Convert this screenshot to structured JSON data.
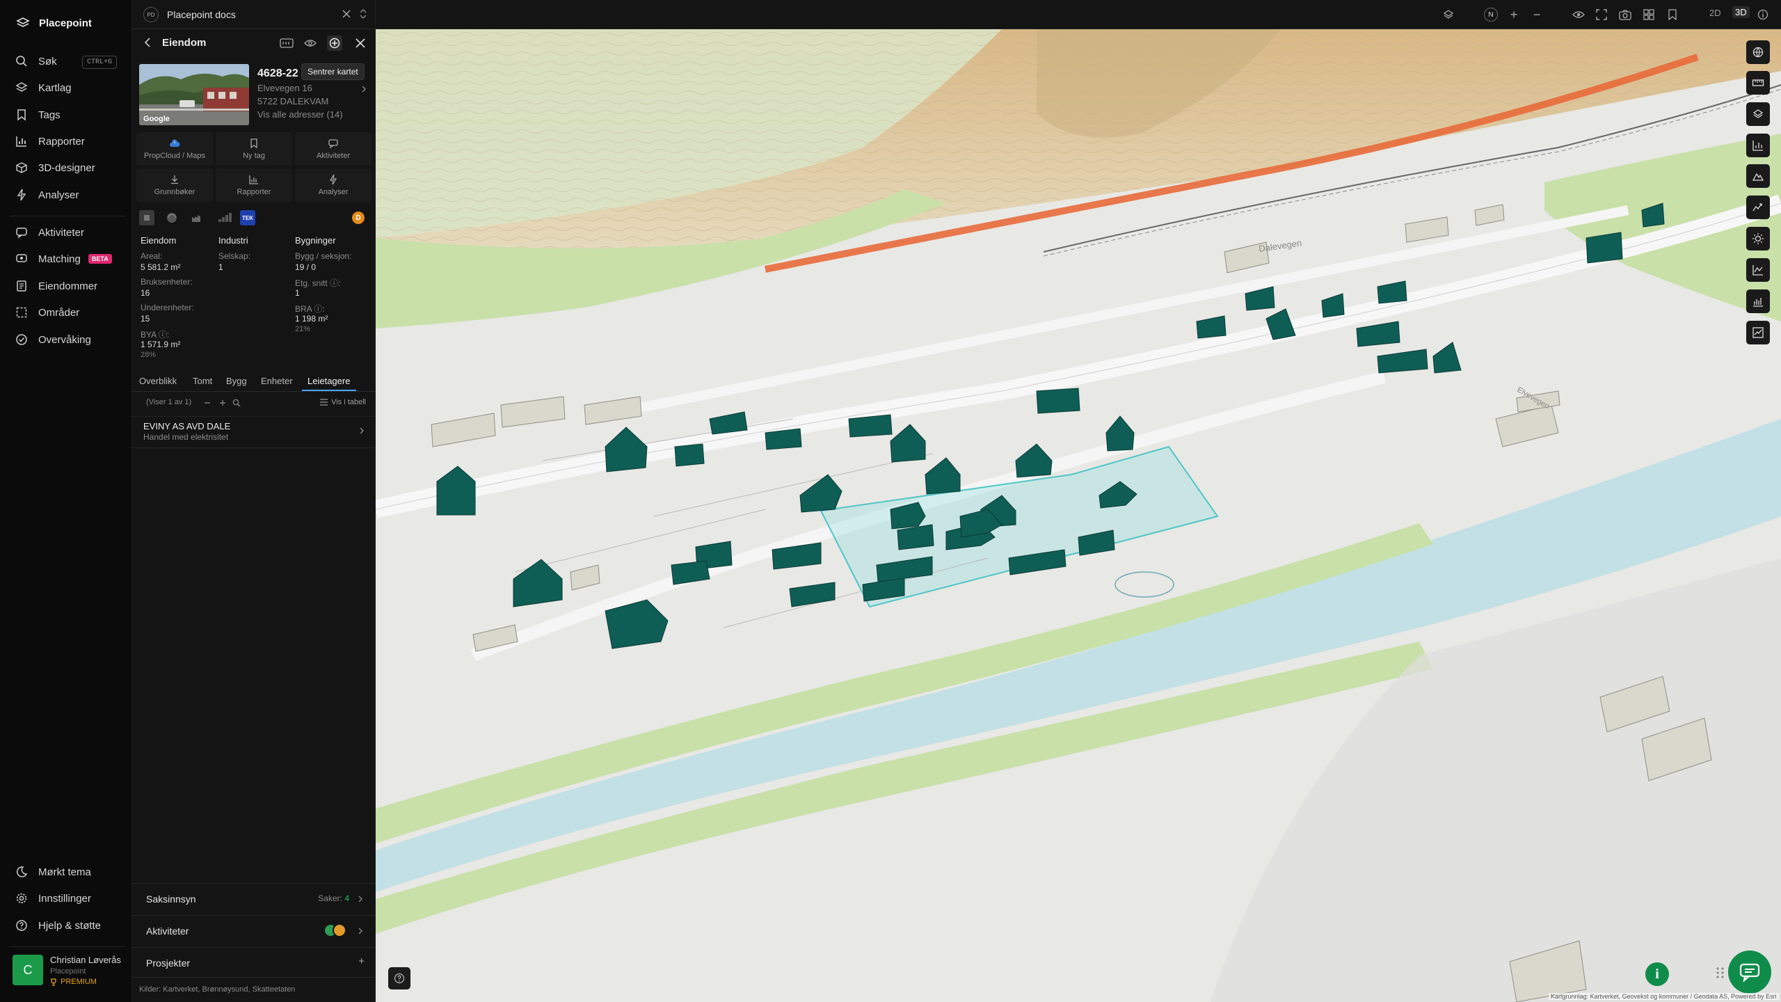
{
  "app": {
    "name": "Placepoint"
  },
  "nav": {
    "search": {
      "label": "Søk",
      "shortcut": "CTRL+G"
    },
    "items_top": [
      "Kartlag",
      "Tags",
      "Rapporter",
      "3D-designer",
      "Analyser"
    ],
    "aktiviteter": "Aktiviteter",
    "matching": {
      "label": "Matching",
      "badge": "BETA"
    },
    "eiendommer": "Eiendommer",
    "omrader": "Områder",
    "overvaking": "Overvåking",
    "bottom": [
      "Mørkt tema",
      "Innstillinger",
      "Hjelp & støtte"
    ],
    "user": {
      "initial": "C",
      "name": "Christian Løverås",
      "org": "Placepoint",
      "plan": "PREMIUM"
    }
  },
  "docs": {
    "badge": "PD",
    "title": "Placepoint docs"
  },
  "property": {
    "header": "Eiendom",
    "tooltip": "Sentrer kartet",
    "id": "4628-22",
    "address": "Elvevegen 16",
    "postal": "5722 DALEKVAM",
    "all_addresses": "Vis alle adresser (14)",
    "photo_credit": "Google"
  },
  "actions": [
    "PropCloud / Maps",
    "Ny tag",
    "Aktiviteter",
    "Grunnbøker",
    "Rapporter",
    "Analyser"
  ],
  "sources": {
    "tek": "TEK",
    "d": "D"
  },
  "stats": {
    "eiendom": {
      "heading": "Eiendom",
      "areal_label": "Areal:",
      "areal_value": "5 581.2 m²",
      "bruksenheter_label": "Bruksenheter:",
      "bruksenheter_value": "16",
      "underenheter_label": "Underenheter:",
      "underenheter_value": "15",
      "bya_label": "BYA ⓘ:",
      "bya_value": "1 571.9 m²",
      "bya_pct": "28%"
    },
    "industri": {
      "heading": "Industri",
      "selskap_label": "Selskap:",
      "selskap_value": "1"
    },
    "bygninger": {
      "heading": "Bygninger",
      "bygg_label": "Bygg / seksjon:",
      "bygg_value": "19 / 0",
      "etg_label": "Etg. snitt ⓘ:",
      "etg_value": "1",
      "bra_label": "BRA ⓘ:",
      "bra_value": "1 198 m²",
      "bra_pct": "21%"
    }
  },
  "tabs": [
    "Overblikk",
    "Tomt",
    "Bygg",
    "Enheter",
    "Leietagere"
  ],
  "active_tab": "Leietagere",
  "list": {
    "count": "(Viser 1 av 1)",
    "table_link": "Vis i tabell",
    "rows": [
      {
        "name": "EVINY AS AVD DALE",
        "desc": "Handel med elektrisitet"
      }
    ]
  },
  "sections": {
    "saksinnsyn": {
      "label": "Saksinnsyn",
      "meta_label": "Saker:",
      "meta_value": "4"
    },
    "aktiviteter": {
      "label": "Aktiviteter"
    },
    "prosjekter": {
      "label": "Prosjekter",
      "action": "+"
    }
  },
  "kilder": {
    "label": "Kilder:",
    "items": [
      "Kartverket,",
      "Brønnøysund,",
      "Skatteetaten"
    ]
  },
  "topbar": {
    "north": "N",
    "zoom_in": "+",
    "zoom_out": "−",
    "mode_2d": "2D",
    "mode_3d": "3D",
    "active_mode": "3D"
  },
  "map": {
    "street_labels": [
      "Dalevegen",
      "Elvevegen"
    ],
    "attribution": "Kartgrunnlag: Kartverket, Geovekst og kommuner / Geodata AS, Powered by Esri"
  },
  "colors": {
    "accent": "#4aa3ff",
    "building": "#0f5e55",
    "selection": "#8fe0e0",
    "river": "#c2e0e5",
    "grass": "#c9e0a9",
    "green": "#0f8c4a"
  }
}
